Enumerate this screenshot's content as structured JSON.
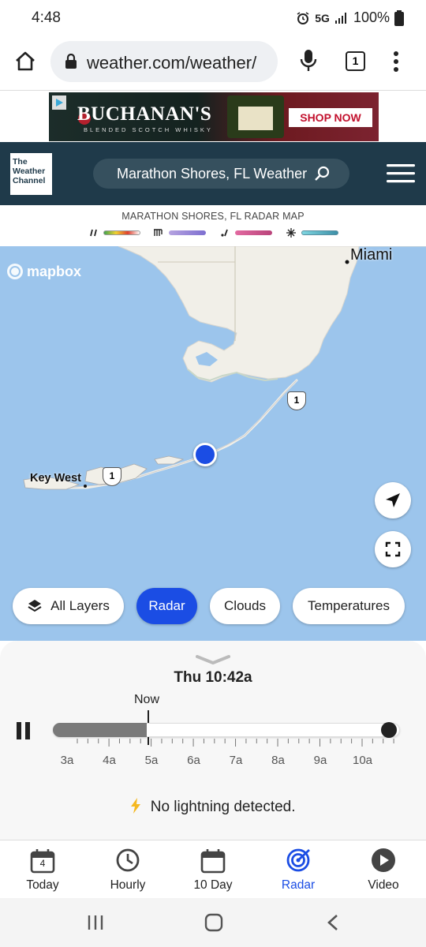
{
  "status_bar": {
    "time": "4:48",
    "network": "5G",
    "battery": "100%"
  },
  "browser": {
    "url": "weather.com/weather/",
    "tab_count": "1"
  },
  "ad": {
    "brand": "BUCHANAN'S",
    "tagline": "BLENDED SCOTCH WHISKY",
    "cta": "SHOP NOW"
  },
  "header": {
    "logo_line1": "The",
    "logo_line2": "Weather",
    "logo_line3": "Channel",
    "search_text": "Marathon Shores, FL Weather"
  },
  "legend": {
    "title": "MARATHON SHORES, FL RADAR MAP",
    "items": [
      {
        "type": "rain",
        "icon": "rain-icon",
        "colors": [
          "#3fa34d",
          "#f2d230",
          "#e0402e",
          "#fff"
        ]
      },
      {
        "type": "mix",
        "icon": "mix-icon",
        "colors": [
          "#9b7fd4",
          "#7d6fd0"
        ]
      },
      {
        "type": "ice",
        "icon": "ice-icon",
        "colors": [
          "#e26aa1",
          "#b9437a"
        ]
      },
      {
        "type": "snow",
        "icon": "snow-icon",
        "colors": [
          "#7fd6e0",
          "#3c8fa7"
        ]
      }
    ]
  },
  "map": {
    "attribution": "mapbox",
    "labels": {
      "miami": "Miami",
      "key_west": "Key West"
    },
    "route_shields": [
      "1",
      "1"
    ],
    "chips": [
      {
        "label": "All Layers",
        "active": false
      },
      {
        "label": "Radar",
        "active": true
      },
      {
        "label": "Clouds",
        "active": false
      },
      {
        "label": "Temperatures",
        "active": false
      }
    ]
  },
  "timeline": {
    "current_time": "Thu 10:42a",
    "now_label": "Now",
    "progress": 0.27,
    "labels": [
      "3a",
      "4a",
      "5a",
      "6a",
      "7a",
      "8a",
      "9a",
      "10a"
    ],
    "lightning_status": "No lightning detected."
  },
  "bottom_nav": [
    {
      "label": "Today",
      "icon": "calendar-day-icon",
      "badge": "4"
    },
    {
      "label": "Hourly",
      "icon": "clock-icon"
    },
    {
      "label": "10 Day",
      "icon": "calendar-icon"
    },
    {
      "label": "Radar",
      "icon": "radar-icon",
      "active": true
    },
    {
      "label": "Video",
      "icon": "play-icon"
    }
  ],
  "colors": {
    "accent": "#1b4de4",
    "header_bg": "#1f3a4a",
    "water": "#9cc5ec",
    "land": "#f1efe8"
  }
}
